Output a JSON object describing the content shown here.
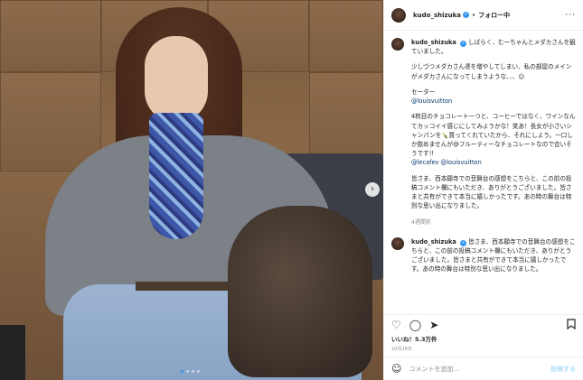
{
  "header": {
    "username": "kudo_shizuka",
    "separator": "•",
    "follow_label": "フォロー中",
    "more_icon": "more-horizontal-icon"
  },
  "caption": {
    "username": "kudo_shizuka",
    "line1": "しばらく、むーちゃんとメダカさんを観ていました。",
    "para2": "少しづつメダカさん達を増やしてしまい、私の部屋のメインがメダカさんになってしまうような、、、☺",
    "sweater_label": "セーター",
    "mention1": "@louisvuitton",
    "para3": "4枚目のチョコレート一つと、コーヒーではなく、ワインなんてカッコイイ感じにしてみようかな！笑あ！長女が小さいシャンパンを🍾買ってくれていたから、それにしよう。一口しか飲めませんが😅フルーティーなチョコレートなので合いそうです!!",
    "mention2": "@lecafev",
    "mention3": "@louisvuitton",
    "para4": "皆さま、西本願寺での音舞台の感想をこちらと、この前の投稿コメント欄にもいただき、ありがとうございました。皆さまと共有ができて本当に嬉しかったです。あの時の舞台は特別な思い出になりました。",
    "age": "4週間前"
  },
  "reply": {
    "username": "kudo_shizuka",
    "text": "皆さま、西本願寺での音舞台の感想をこちらと、この前の投稿コメント欄にもいただき、ありがとうございました。皆さまと共有ができて本当に嬉しかったです。あの時の舞台は特別な思い出になりました。"
  },
  "actions": {
    "like_icon": "heart-icon",
    "comment_icon": "comment-icon",
    "share_icon": "paper-plane-icon",
    "save_icon": "bookmark-icon"
  },
  "likes_text": "いいね！5.3万件",
  "date_text": "10月26日",
  "composer": {
    "placeholder": "コメントを追加...",
    "post_label": "投稿する"
  },
  "carousel": {
    "total": 4,
    "active_index": 0
  }
}
